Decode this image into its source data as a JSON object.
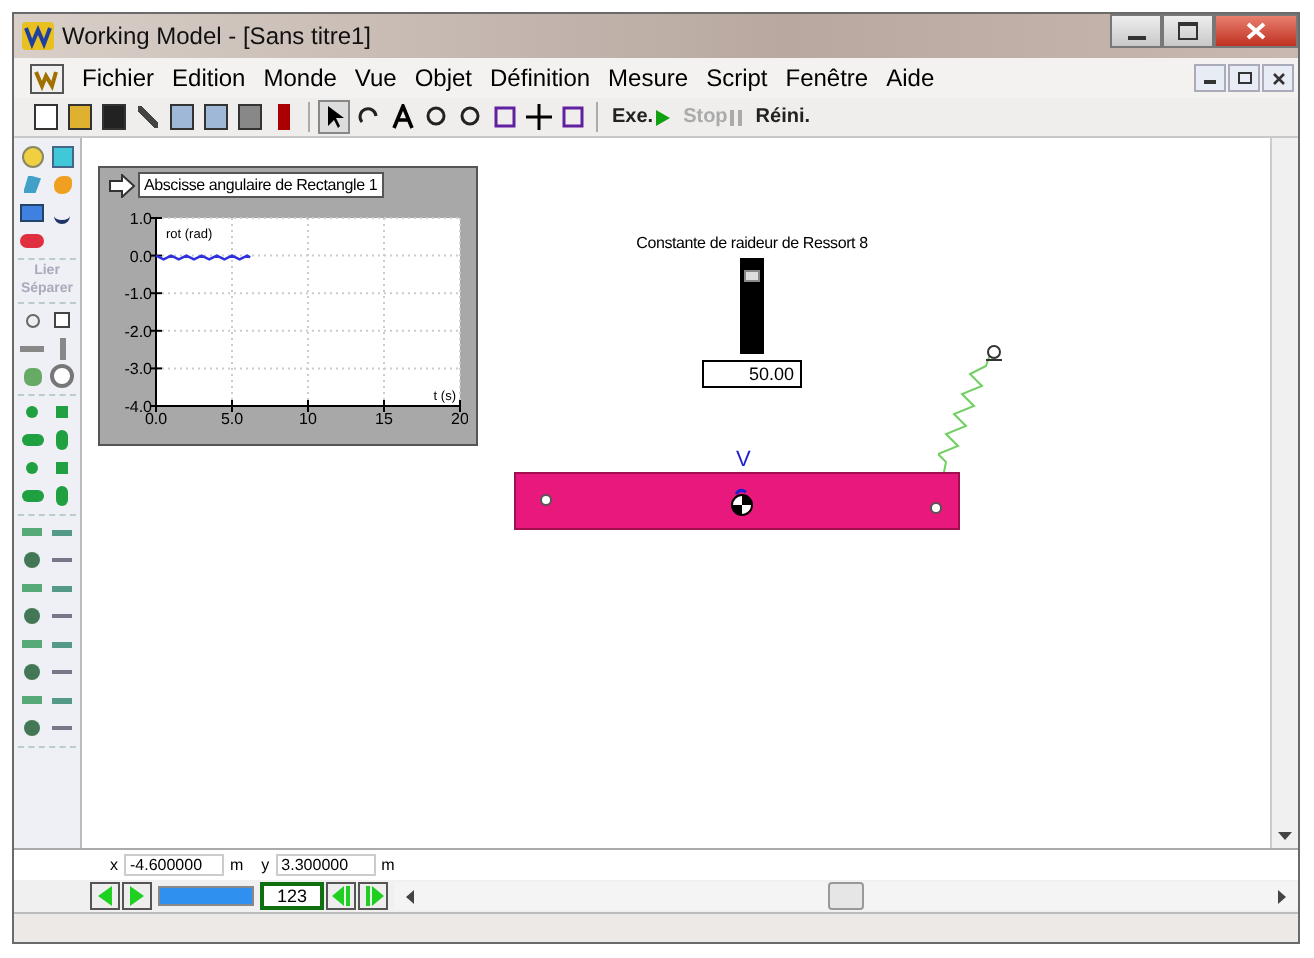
{
  "window": {
    "title": "Working Model - [Sans titre1]"
  },
  "menu": [
    "Fichier",
    "Edition",
    "Monde",
    "Vue",
    "Objet",
    "Définition",
    "Mesure",
    "Script",
    "Fenêtre",
    "Aide"
  ],
  "toolbar": {
    "run": "Exe.",
    "stop": {
      "label": "Stop",
      "disabled": true
    },
    "reset": "Réini."
  },
  "palette": {
    "join": {
      "label": "Lier",
      "disabled": true
    },
    "split": {
      "label": "Séparer",
      "disabled": true
    }
  },
  "graph": {
    "title": "Abscisse angulaire de Rectangle 1",
    "chart_data": {
      "type": "line",
      "grid": true,
      "xlabel": "t (s)",
      "x": [
        0,
        0.5,
        1,
        1.5,
        2,
        2.5,
        3,
        3.5,
        4,
        4.5,
        5,
        5.5,
        6,
        6.2
      ],
      "series": [
        {
          "name": "rot (rad)",
          "color": "#3030e0",
          "values": [
            0,
            -0.1,
            0,
            -0.1,
            0,
            -0.1,
            0,
            -0.1,
            0,
            -0.1,
            0,
            -0.1,
            0,
            -0.05
          ]
        }
      ],
      "xlim": [
        0,
        20
      ],
      "ylim": [
        -4,
        1
      ],
      "xticks": [
        {
          "value": 0,
          "label": "0.0"
        },
        {
          "value": 5,
          "label": "5.0"
        },
        {
          "value": 10,
          "label": "10"
        },
        {
          "value": 15,
          "label": "15"
        },
        {
          "value": 20,
          "label": "20"
        }
      ],
      "yticks": [
        {
          "value": 1,
          "label": "1.0"
        },
        {
          "value": 0,
          "label": "0.0"
        },
        {
          "value": -1,
          "label": "-1.0"
        },
        {
          "value": -2,
          "label": "-2.0"
        },
        {
          "value": -3,
          "label": "-3.0"
        },
        {
          "value": -4,
          "label": "-4.0"
        }
      ]
    }
  },
  "meter": {
    "label": "Constante de raideur de Ressort 8",
    "level": 0.88,
    "value": "50.00"
  },
  "body": {
    "label": "V"
  },
  "coordinates": {
    "x_label": "x",
    "x_value": "-4.600000",
    "x_unit": "m",
    "y_label": "y",
    "y_value": "3.300000",
    "y_unit": "m"
  },
  "tape": {
    "level": 1,
    "frame": "123"
  }
}
